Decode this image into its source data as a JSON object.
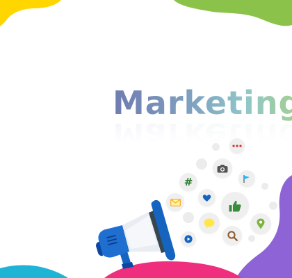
{
  "title": "Marketing",
  "colors": {
    "yellow_blob": "#ffd600",
    "green_blob": "#8bc34a",
    "purple_blob": "#8e63d6",
    "pink_blob": "#ef2f7e",
    "cyan_blob": "#1fb4d6",
    "megaphone_blue": "#1565c0"
  },
  "icons": [
    "more-dots-icon",
    "camera-icon",
    "hashtag-icon",
    "flag-icon",
    "mail-icon",
    "heart-icon",
    "thumbs-up-icon",
    "chat-bubble-icon",
    "location-pin-icon",
    "search-icon",
    "play-icon",
    "megaphone-icon"
  ]
}
